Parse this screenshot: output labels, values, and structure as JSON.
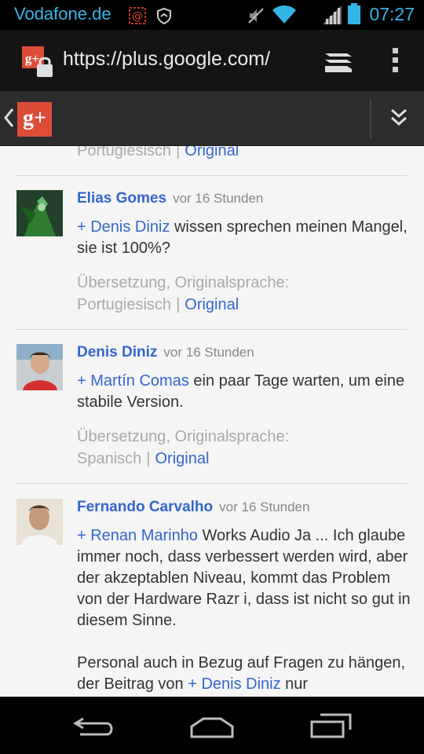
{
  "status_bar": {
    "carrier": "Vodafone.de",
    "time": "07:27",
    "icons": [
      "email-notification-icon",
      "vpn-shield-icon",
      "mute-icon",
      "wifi-icon",
      "signal-icon",
      "battery-icon"
    ]
  },
  "browser": {
    "url": "https://plus.google.com/",
    "icons": [
      "gplus-secure-icon",
      "tabs-icon",
      "overflow-menu-icon"
    ]
  },
  "app_bar": {
    "logo": "g+",
    "icons": [
      "back-chevron-icon",
      "expand-double-chevron-icon"
    ]
  },
  "comments": [
    {
      "partial": true,
      "translation_language": "Portugiesisch",
      "original_label": "Original"
    },
    {
      "author": "Elias Gomes",
      "time": "vor 16 Stunden",
      "mention": "+ Denis Diniz",
      "text": " wissen sprechen meinen Mangel, sie ist 100%?",
      "translation_label": "Übersetzung, Originalsprache:",
      "translation_language": "Portugiesisch",
      "original_label": "Original"
    },
    {
      "author": "Denis Diniz",
      "time": "vor 16 Stunden",
      "mention": "+ Martín Comas",
      "text": " ein paar Tage warten, um eine stabile Version.",
      "translation_label": "Übersetzung, Originalsprache:",
      "translation_language": "Spanisch",
      "original_label": "Original"
    },
    {
      "author": "Fernando Carvalho",
      "time": "vor 16 Stunden",
      "mention": "+ Renan Marinho",
      "text": " Works Audio Ja ... Ich glaube immer noch, dass verbessert werden wird, aber der akzeptablen Niveau, kommt das Problem von der Hardware Razr i, dass ist nicht so gut in diesem Sinne.",
      "text2_before": "Personal auch in Bezug auf Fragen zu hängen, der Beitrag von ",
      "mention2": "+ Denis Diniz",
      "text2_after": " nur"
    }
  ],
  "colors": {
    "status_accent": "#33b5e5",
    "link_blue": "#3366cc",
    "gplus_red": "#dd4b39"
  },
  "nav_bar": {
    "icons": [
      "back-icon",
      "home-icon",
      "recent-apps-icon"
    ]
  }
}
